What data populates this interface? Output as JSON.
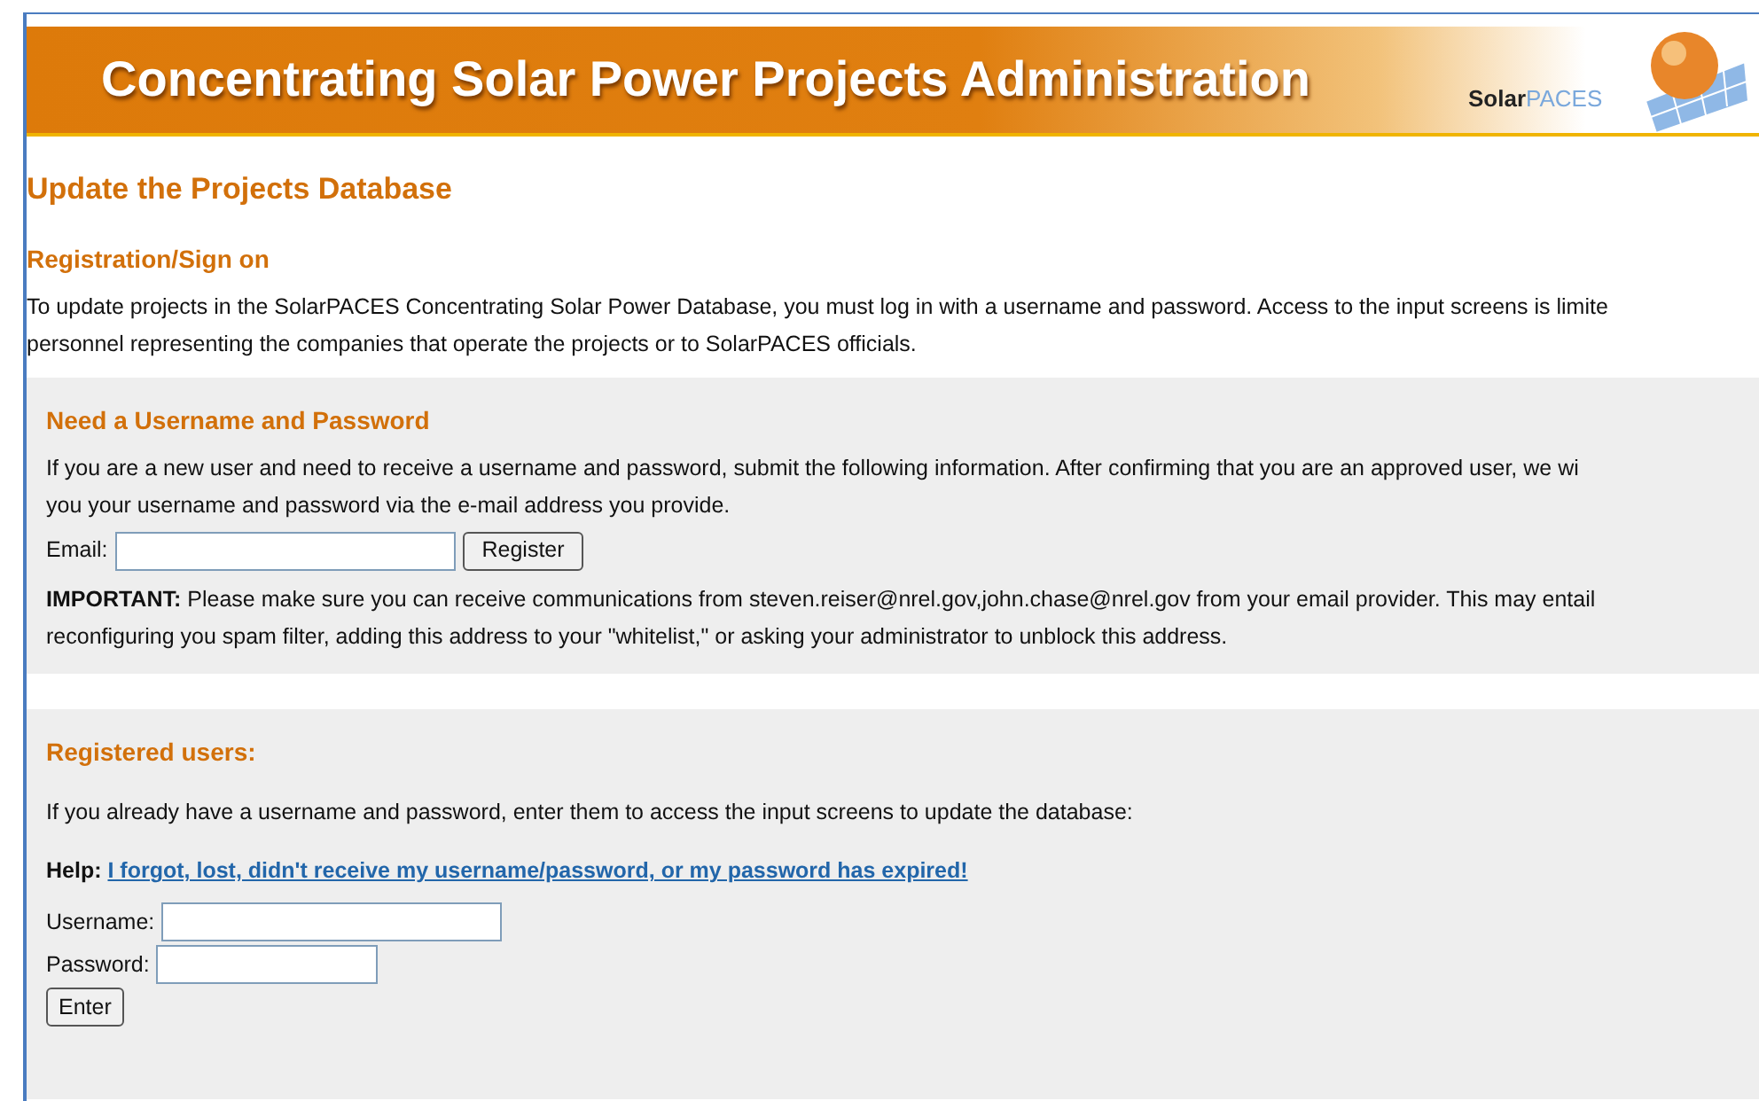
{
  "header": {
    "title": "Concentrating Solar Power Projects Administration",
    "logo": {
      "prefix": "Solar",
      "suffix": "PACES"
    }
  },
  "page_title": "Update the Projects Database",
  "section_title": "Registration/Sign on",
  "intro": [
    "To update projects in the SolarPACES Concentrating Solar Power Database, you must log in with a username and password. Access to the input screens is limite",
    "personnel representing the companies that operate the projects or to SolarPACES officials."
  ],
  "new_user": {
    "title": "Need a Username and Password",
    "text": [
      "If you are a new user and need to receive a username and password, submit the following information. After confirming that you are an approved user, we wi",
      "you your username and password via the e-mail address you provide."
    ],
    "email_label": "Email:",
    "button": "Register",
    "important_label": "IMPORTANT:",
    "important": [
      "Please make sure you can receive communications from steven.reiser@nrel.gov,john.chase@nrel.gov from your email provider. This may entail",
      "reconfiguring you spam filter, adding this address to your \"whitelist,\" or asking your administrator to unblock this address."
    ]
  },
  "registered": {
    "title": "Registered users:",
    "text": "If you already have a username and password, enter them to access the input screens to update the database:",
    "help_label": "Help:",
    "help_link": "I forgot, lost, didn't receive my username/password, or my password has expired!",
    "username_label": "Username:",
    "password_label": "Password:",
    "button": "Enter"
  }
}
